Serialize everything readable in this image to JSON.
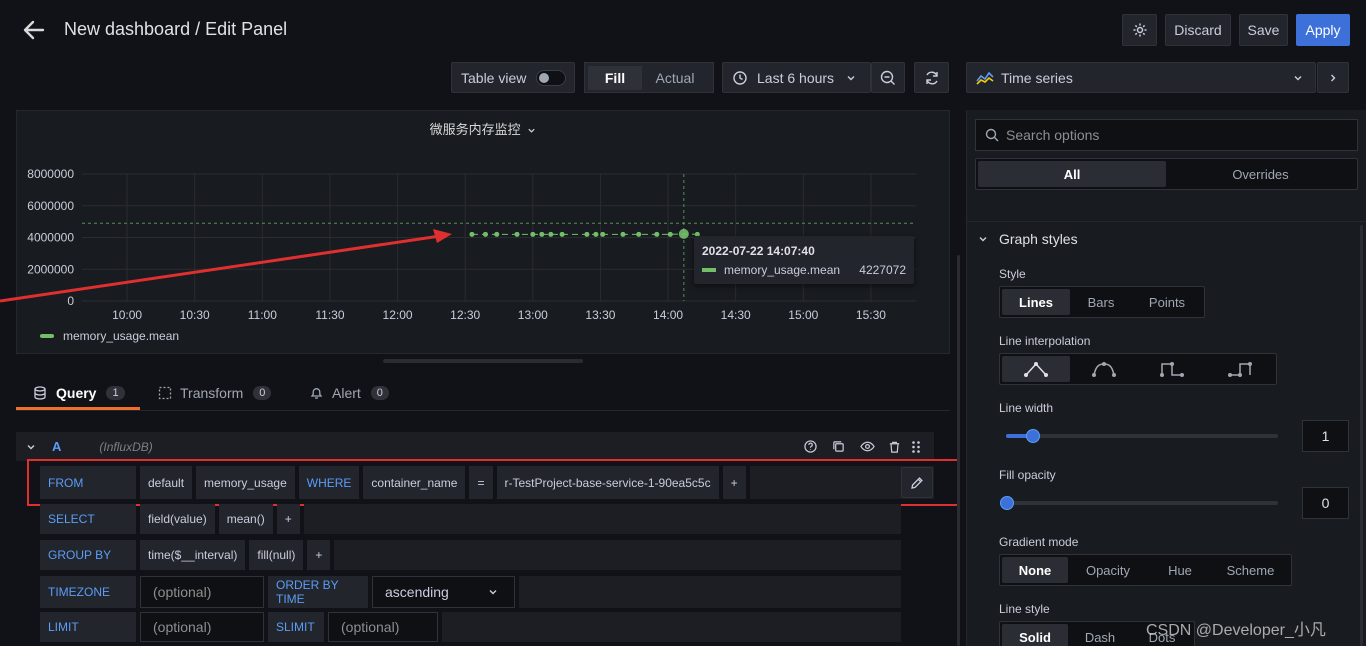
{
  "header": {
    "title": "New dashboard / Edit Panel",
    "discard_label": "Discard",
    "save_label": "Save",
    "apply_label": "Apply"
  },
  "toolbar": {
    "table_view_label": "Table view",
    "fill_label": "Fill",
    "actual_label": "Actual",
    "time_range_label": "Last 6 hours"
  },
  "panel": {
    "title": "微服务内存监控",
    "legend_label": "memory_usage.mean",
    "tooltip": {
      "time": "2022-07-22 14:07:40",
      "series": "memory_usage.mean",
      "value": "4227072"
    }
  },
  "chart_data": {
    "type": "line",
    "title": "微服务内存监控",
    "x_ticks": [
      "10:00",
      "10:30",
      "11:00",
      "11:30",
      "12:00",
      "12:30",
      "13:00",
      "13:30",
      "14:00",
      "14:30",
      "15:00",
      "15:30"
    ],
    "y_ticks": [
      "8000000",
      "6000000",
      "4000000",
      "2000000",
      "0"
    ],
    "ylim": [
      0,
      8000000
    ],
    "series": [
      {
        "name": "memory_usage.mean",
        "color": "#73bf69",
        "x": [
          "12:33",
          "12:39",
          "12:44",
          "12:53",
          "13:00",
          "13:04",
          "13:08",
          "13:13",
          "13:24",
          "13:28",
          "13:31",
          "13:40",
          "13:47",
          "13:55",
          "14:01",
          "14:07",
          "14:13"
        ],
        "values": [
          4200000,
          4200000,
          4200000,
          4200000,
          4200000,
          4200000,
          4200000,
          4200000,
          4200000,
          4200000,
          4200000,
          4200000,
          4200000,
          4200000,
          4200000,
          4227072,
          4200000
        ]
      }
    ],
    "grid": true,
    "legend": "bottom-left"
  },
  "tabs": {
    "query_label": "Query",
    "query_count": "1",
    "transform_label": "Transform",
    "transform_count": "0",
    "alert_label": "Alert",
    "alert_count": "0"
  },
  "query": {
    "ref_id": "A",
    "datasource": "(InfluxDB)",
    "from_label": "FROM",
    "from_policy": "default",
    "from_measurement": "memory_usage",
    "where_label": "WHERE",
    "where_key": "container_name",
    "where_op": "=",
    "where_value": "r-TestProject-base-service-1-90ea5c5c",
    "plus": "+",
    "select_label": "SELECT",
    "select_field": "field(value)",
    "select_func": "mean()",
    "group_label": "GROUP BY",
    "group_time": "time($__interval)",
    "group_fill": "fill(null)",
    "timezone_label": "TIMEZONE",
    "optional": "(optional)",
    "order_label": "ORDER BY TIME",
    "order_value": "ascending",
    "limit_label": "LIMIT",
    "slimit_label": "SLIMIT"
  },
  "options": {
    "viz_label": "Time series",
    "search_placeholder": "Search options",
    "all_label": "All",
    "overrides_label": "Overrides",
    "graph_styles_label": "Graph styles",
    "style_label": "Style",
    "style_options": [
      "Lines",
      "Bars",
      "Points"
    ],
    "interp_label": "Line interpolation",
    "line_width_label": "Line width",
    "line_width_value": "1",
    "fill_opacity_label": "Fill opacity",
    "fill_opacity_value": "0",
    "gradient_label": "Gradient mode",
    "gradient_options": [
      "None",
      "Opacity",
      "Hue",
      "Scheme"
    ],
    "line_style_label": "Line style",
    "line_style_options": [
      "Solid",
      "Dash",
      "Dots"
    ]
  },
  "watermark": "CSDN @Developer_小凡",
  "colors": {
    "accent": "#3d71d9",
    "series": "#73bf69",
    "highlight": "#e02f2f"
  }
}
